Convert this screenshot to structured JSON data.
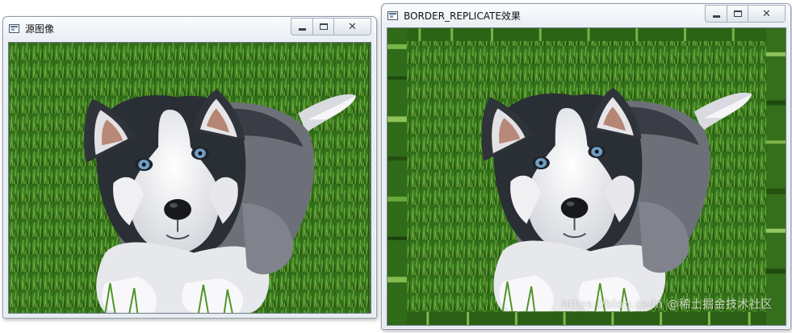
{
  "windows": {
    "source": {
      "title": "源图像"
    },
    "replicate": {
      "title": "BORDER_REPLICATE效果",
      "watermark": "https://blog.csdn @稀土掘金技术社区"
    }
  },
  "controls": {
    "minimize_icon": "minimize-icon",
    "maximize_icon": "maximize-icon",
    "close_icon": "close-icon"
  },
  "image": {
    "subject": "husky puppy lying on grass",
    "grass_color": "#3b7a1f",
    "fur_dark": "#2a2e35",
    "fur_light": "#f2f2f4",
    "eye_color": "#6f9ec8"
  }
}
